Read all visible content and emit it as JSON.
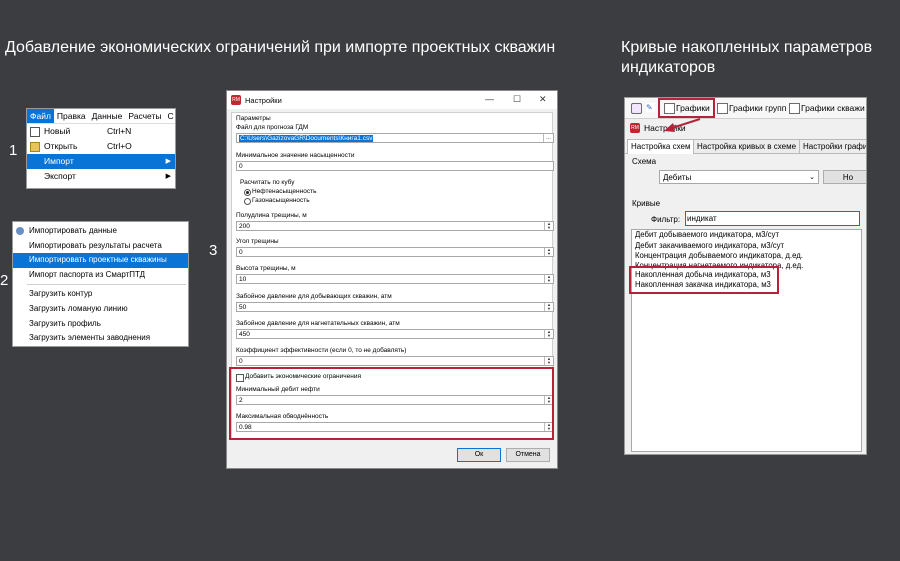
{
  "headings": {
    "left": "Добавление экономических ограничений при импорте проектных скважин",
    "right_line1": "Кривые накопленных параметров",
    "right_line2": "индикаторов"
  },
  "steps": [
    "1",
    "2",
    "3"
  ],
  "file_menu": {
    "menubar": [
      "Файл",
      "Правка",
      "Данные",
      "Расчеты",
      "С"
    ],
    "items": [
      {
        "label": "Новый",
        "shortcut": "Ctrl+N"
      },
      {
        "label": "Открыть",
        "shortcut": "Ctrl+O"
      },
      {
        "label": "Импорт",
        "shortcut": ""
      },
      {
        "label": "Экспорт",
        "shortcut": ""
      }
    ]
  },
  "import_menu": {
    "items": [
      "Импортировать данные",
      "Импортировать результаты расчета",
      "Импортировать проектные скважины",
      "Импорт паспорта из СмартПТД",
      "Загрузить контур",
      "Загрузить ломаную линию",
      "Загрузить профиль",
      "Загрузить элементы заводнения"
    ]
  },
  "dialog": {
    "title": "Настройки",
    "app_icon_text": "RM",
    "section": "Параметры",
    "file_label": "Файл для прогноза ГДМ",
    "file_path": "C:\\Users\\GazizovaGR\\Documents\\Книга1.csv",
    "min_sat_label": "Минимальное значение насыщенности",
    "min_sat_value": "0",
    "cube_group_label": "Расчитать по кубу",
    "radio_oil": "Нефтенасыщенность",
    "radio_gas": "Газонасыщенность",
    "half_frac_label": "Полудлина трещины, м",
    "half_frac_value": "200",
    "frac_angle_label": "Угол трещины",
    "frac_angle_value": "0",
    "frac_height_label": "Высота трещины, м",
    "frac_height_value": "10",
    "bhp_prod_label": "Забойное давление для добывающих скважин, атм",
    "bhp_prod_value": "50",
    "bhp_inj_label": "Забойное давление для нагнетательных скважин, атм",
    "bhp_inj_value": "450",
    "eff_label": "Коэффициент эффективности (если 0, то не добавлять)",
    "eff_value": "0",
    "econ_check_label": "Добавить экономические ограничения",
    "min_rate_label": "Минимальный дебит нефти",
    "min_rate_value": "2",
    "max_wc_label": "Максимальная обводнённость",
    "max_wc_value": "0.98",
    "ok": "Ок",
    "cancel": "Отмена"
  },
  "curves": {
    "toolbar": [
      "Графики",
      "Графики групп",
      "Графики скважи"
    ],
    "app_icon_text": "RM",
    "settings_label": "Настройки",
    "tabs": [
      "Настройка схем",
      "Настройка кривых в схеме",
      "Настройки графи"
    ],
    "schema_label": "Схема",
    "schema_value": "Дебиты",
    "new_button": "Но",
    "curves_label": "Кривые",
    "filter_label": "Фильтр:",
    "filter_value": "индикат",
    "list": [
      "Дебит добываемого индикатора, м3/сут",
      "Дебит закачиваемого индикатора, м3/сут",
      "Концентрация добываемого индикатора, д.ед.",
      "Концентрация нагнетаемого индикатора, д.ед.",
      "Накопленная добыча индикатора, м3",
      "Накопленная закачка индикатора, м3"
    ]
  },
  "colors": {
    "background": "#3b3d40",
    "highlight": "#b5223a",
    "selection": "#0a74d6"
  }
}
